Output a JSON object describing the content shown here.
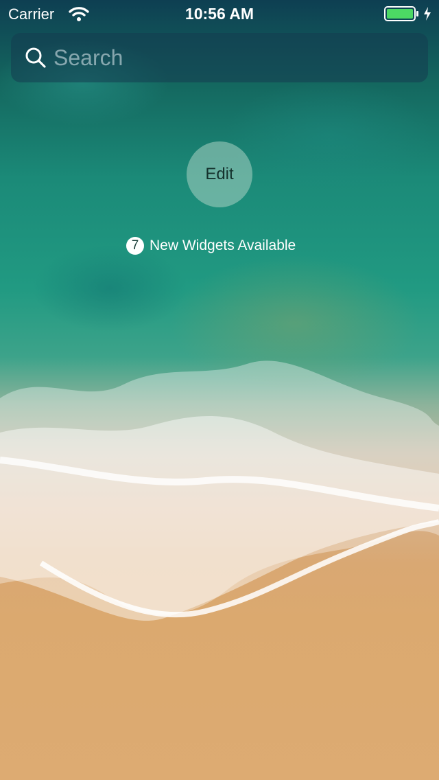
{
  "status_bar": {
    "carrier": "Carrier",
    "time": "10:56 AM",
    "wifi_icon": "wifi-icon",
    "battery_icon": "battery-icon",
    "charging_icon": "charging-bolt-icon",
    "battery_color": "#4cd964"
  },
  "search": {
    "placeholder": "Search",
    "icon": "search-icon"
  },
  "edit_button": {
    "label": "Edit"
  },
  "widgets_notice": {
    "count": "7",
    "label": "New Widgets Available"
  }
}
